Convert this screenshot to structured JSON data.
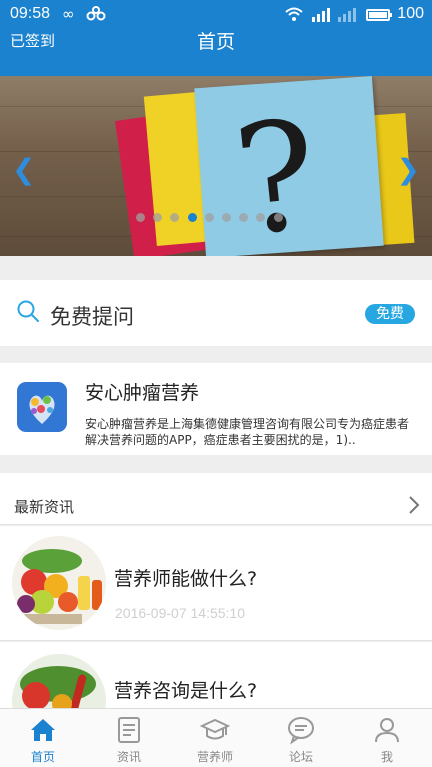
{
  "status_bar": {
    "time": "09:58",
    "battery": "100"
  },
  "header": {
    "left_label": "已签到",
    "title": "首页"
  },
  "banner": {
    "dot_count": 9,
    "active_dot": 3
  },
  "question": {
    "placeholder_label": "免费提问",
    "badge": "免费"
  },
  "app_card": {
    "name": "安心肿瘤营养",
    "description": "安心肿瘤营养是上海集德健康管理咨询有限公司专为癌症患者解决营养问题的APP，癌症患者主要困扰的是，1).."
  },
  "news": {
    "section_title": "最新资讯",
    "items": [
      {
        "title": "营养师能做什么?",
        "date": "2016-09-07 14:55:10"
      },
      {
        "title": "营养咨询是什么?",
        "date": ""
      }
    ]
  },
  "tabbar": {
    "tabs": [
      {
        "label": "首页",
        "icon": "home-icon"
      },
      {
        "label": "资讯",
        "icon": "news-doc-icon"
      },
      {
        "label": "营养师",
        "icon": "graduation-cap-icon"
      },
      {
        "label": "论坛",
        "icon": "chat-bubble-icon"
      },
      {
        "label": "我",
        "icon": "person-icon"
      }
    ],
    "active_index": 0
  },
  "colors": {
    "primary": "#1b82cf",
    "badge": "#27a7e2"
  }
}
